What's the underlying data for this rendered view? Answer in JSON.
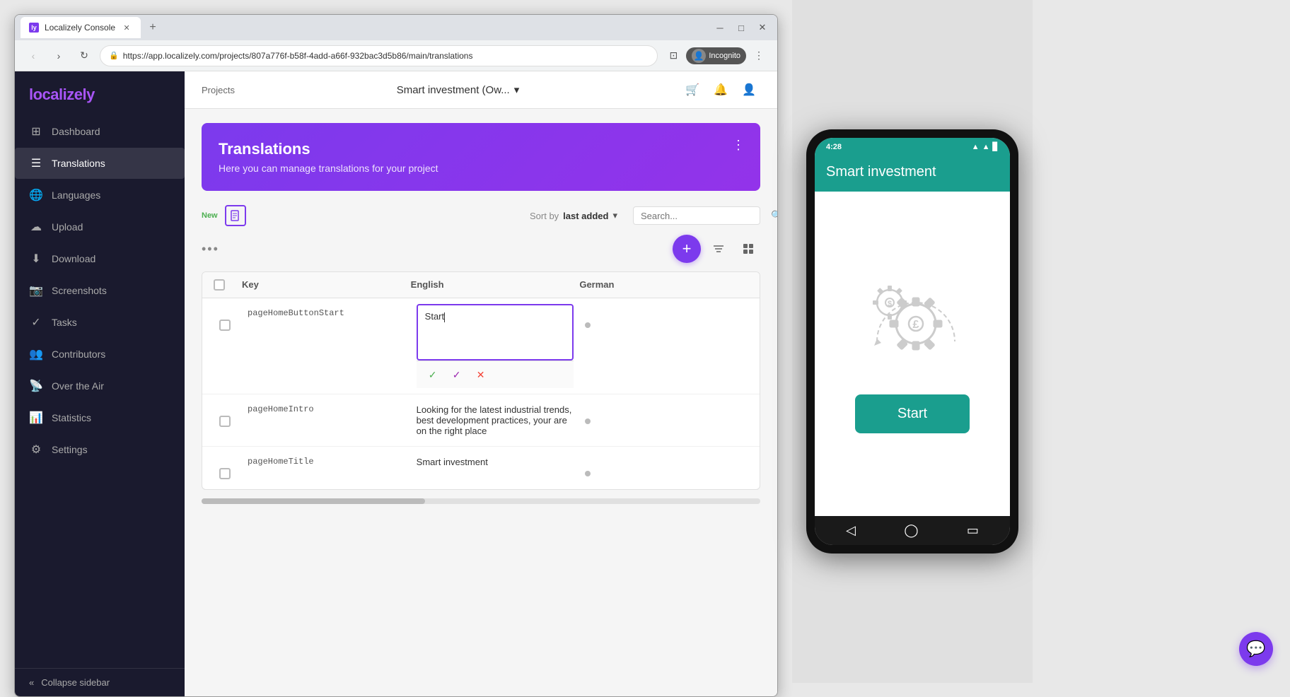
{
  "browser": {
    "tab_title": "Localizely Console",
    "tab_favicon": "ly",
    "url": "https://app.localizely.com/projects/807a776f-b58f-4add-a66f-932bac3d5b86/main/translations",
    "incognito_label": "Incognito"
  },
  "topbar": {
    "breadcrumb": "Projects",
    "project_name": "Smart investment (Ow...",
    "dropdown_icon": "▾"
  },
  "sidebar": {
    "logo": "localize",
    "logo_accent": "ly",
    "items": [
      {
        "id": "dashboard",
        "label": "Dashboard",
        "icon": "⊞"
      },
      {
        "id": "translations",
        "label": "Translations",
        "icon": "☰",
        "active": true
      },
      {
        "id": "languages",
        "label": "Languages",
        "icon": "🌐"
      },
      {
        "id": "upload",
        "label": "Upload",
        "icon": "☁"
      },
      {
        "id": "download",
        "label": "Download",
        "icon": "⬇"
      },
      {
        "id": "screenshots",
        "label": "Screenshots",
        "icon": "📷"
      },
      {
        "id": "tasks",
        "label": "Tasks",
        "icon": "✓"
      },
      {
        "id": "contributors",
        "label": "Contributors",
        "icon": "👥"
      },
      {
        "id": "over-the-air",
        "label": "Over the Air",
        "icon": "📡"
      },
      {
        "id": "statistics",
        "label": "Statistics",
        "icon": "📊"
      },
      {
        "id": "settings",
        "label": "Settings",
        "icon": "⚙"
      }
    ],
    "collapse_label": "Collapse sidebar"
  },
  "banner": {
    "title": "Translations",
    "subtitle": "Here you can manage translations for your project",
    "menu_icon": "⋮"
  },
  "toolbar": {
    "new_label": "New",
    "sort_prefix": "Sort by",
    "sort_value": "last added",
    "sort_icon": "▾",
    "search_placeholder": "Search...",
    "search_icon": "🔍",
    "dots": "•••",
    "add_icon": "+",
    "filter_icon": "≡",
    "grid_icon": "⊞"
  },
  "table": {
    "columns": [
      "",
      "Key",
      "English",
      "German"
    ],
    "rows": [
      {
        "key": "pageHomeButtonStart",
        "english": "Start",
        "german": "",
        "editing": true,
        "editor_value": "Start"
      },
      {
        "key": "pageHomeIntro",
        "english": "Looking for the latest industrial trends, best development practices, your are on the right place",
        "german": "",
        "editing": false
      },
      {
        "key": "pageHomeTitle",
        "english": "Smart investment",
        "german": "",
        "editing": false
      }
    ]
  },
  "editor_actions": {
    "confirm_icon": "✓",
    "confirm_alt_icon": "✓",
    "cancel_icon": "✕"
  },
  "mobile": {
    "time": "4:28",
    "status_icons": "▲▲ 📶",
    "app_name": "Smart investment",
    "start_button": "Start"
  }
}
